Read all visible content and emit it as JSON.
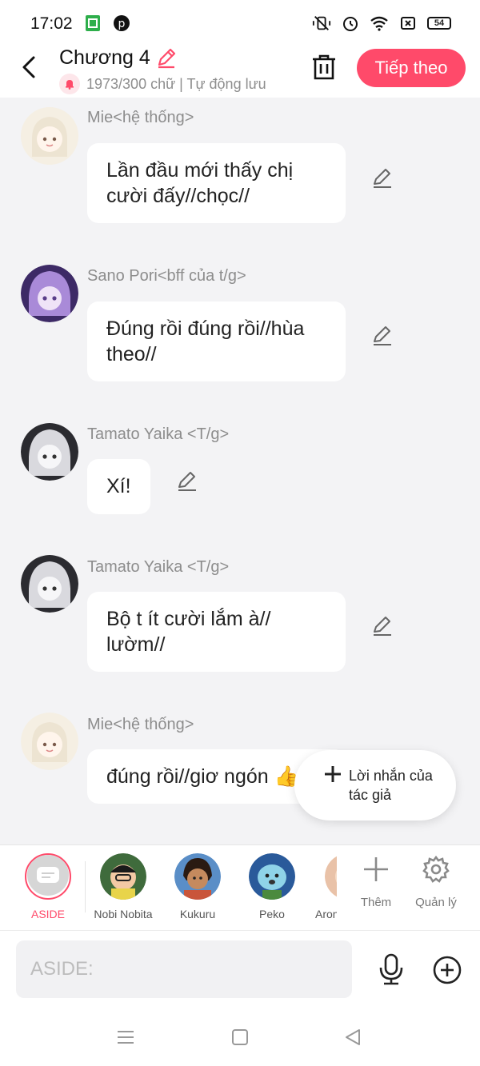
{
  "status_bar": {
    "time": "17:02",
    "battery": "54"
  },
  "header": {
    "title": "Chương 4",
    "subtitle": "1973/300 chữ | Tự động lưu",
    "next_label": "Tiếp theo"
  },
  "messages": [
    {
      "sender": "Mie<hệ thống>",
      "text": "Lần đầu mới thấy chị cười đấy//chọc//"
    },
    {
      "sender": "Sano Pori<bff của t/g>",
      "text": "Đúng rồi đúng rồi//hùa theo//"
    },
    {
      "sender": "Tamato Yaika <T/g>",
      "text": "Xí!"
    },
    {
      "sender": "Tamato Yaika <T/g>",
      "text": "Bộ t ít cười lắm à// lườm//"
    },
    {
      "sender": "Mie<hệ thống>",
      "text": "đúng rồi//giơ ngón 👍//"
    }
  ],
  "fab": {
    "label": "Lời nhắn của tác giả"
  },
  "characters": [
    {
      "name": "ASIDE"
    },
    {
      "name": "Nobi Nobita"
    },
    {
      "name": "Kukuru"
    },
    {
      "name": "Peko"
    },
    {
      "name": "Aron"
    }
  ],
  "bar_actions": {
    "more": "Thêm",
    "manage": "Quản lý"
  },
  "composer": {
    "placeholder": "ASIDE:"
  },
  "colors": {
    "accent": "#ff4a6a",
    "chat_bg": "#f3f3f5"
  }
}
